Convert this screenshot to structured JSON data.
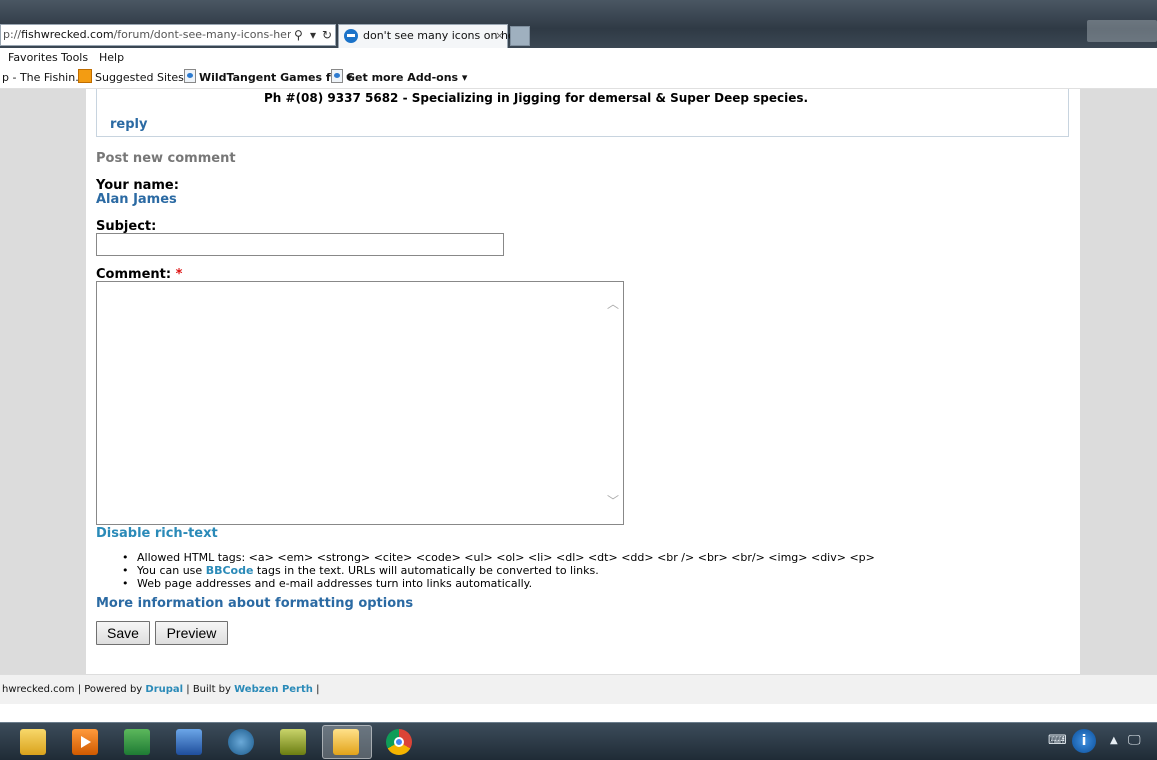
{
  "browser": {
    "address_prefix": "p://",
    "address_host": "fishwrecked.com",
    "address_path": "/forum/dont-see-many-icons-here-anymore",
    "search_glyph": "⚲",
    "dropdown_glyph": "▾",
    "refresh_glyph": "↻",
    "tab_title": "don't see many icons on he...",
    "tab_close": "×"
  },
  "menu": {
    "favorites": "Favorites",
    "tools": "Tools",
    "help": "Help"
  },
  "favorites_bar": {
    "item1": "p - The Fishin...",
    "item2": "Suggested Sites ▾",
    "item3": "WildTangent Games f... ▾",
    "item4": "Get more Add-ons ▾"
  },
  "previous_comment": {
    "phone_line": "Ph #(08) 9337 5682 - Specializing in Jigging for demersal & Super Deep species.",
    "reply_link": "reply"
  },
  "form": {
    "heading": "Post new comment",
    "name_label": "Your name:",
    "name_value": "Alan James",
    "subject_label": "Subject:",
    "subject_value": "",
    "comment_label": "Comment: ",
    "required_marker": "*",
    "comment_value": "",
    "scroll_up_glyph": "︿",
    "scroll_down_glyph": "﹀",
    "disable_rich_text": "Disable rich-text",
    "tips": {
      "allowed_html": "Allowed HTML tags: <a> <em> <strong> <cite> <code> <ul> <ol> <li> <dl> <dt> <dd> <br /> <br> <br/> <img> <div> <p>",
      "bbcode_before": "You can use ",
      "bbcode_link": "BBCode",
      "bbcode_after": " tags in the text. URLs will automatically be converted to links.",
      "links_auto": "Web page addresses and e-mail addresses turn into links automatically."
    },
    "more_info": "More information about formatting options",
    "save_label": "Save",
    "preview_label": "Preview"
  },
  "footer": {
    "site": "hwrecked.com | Powered by ",
    "drupal": "Drupal",
    "built_by": " | Built by ",
    "webzen": "Webzen Perth",
    "end": " |"
  },
  "taskbar": {
    "info_glyph": "i",
    "tray_arrow": "▲",
    "tray_keyboard": "⌨",
    "tray_network": "🖵"
  }
}
